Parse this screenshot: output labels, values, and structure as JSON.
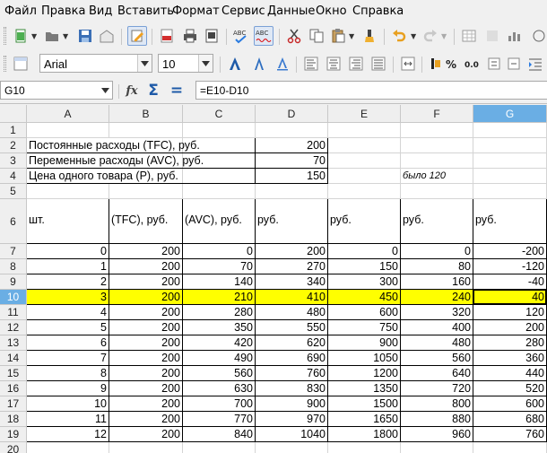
{
  "menu": [
    "Файл",
    "Правка",
    "Вид",
    "Вставить",
    "Формат",
    "Сервис",
    "Данные",
    "Окно",
    "Справка"
  ],
  "toolbar": {
    "font_name": "Arial",
    "font_size": "10",
    "icons": [
      "new-document-icon",
      "open-folder-icon",
      "save-icon",
      "email-icon",
      "edit-mode-icon",
      "export-pdf-icon",
      "print-icon",
      "print-preview-icon",
      "spellcheck-icon",
      "autospellcheck-icon",
      "cut-icon",
      "copy-icon",
      "paste-icon",
      "clone-formatting-icon",
      "undo-icon",
      "redo-icon",
      "bold-icon",
      "italic-icon",
      "underline-icon",
      "align-left-icon",
      "align-center-icon",
      "align-right-icon",
      "justify-icon",
      "merge-cells-icon",
      "currency-icon",
      "percent-icon",
      "number-format-icon"
    ]
  },
  "formula_bar": {
    "cell_ref": "G10",
    "wizard_label": "fx",
    "sum_label": "Σ",
    "equals_label": "=",
    "formula": "=E10-D10"
  },
  "colors": {
    "selection_header": "#6aaee4",
    "highlight_row": "#ffff00"
  },
  "sheet": {
    "columns": [
      "A",
      "B",
      "C",
      "D",
      "E",
      "F",
      "G"
    ],
    "selected_column": "G",
    "selected_row": "10",
    "rows": [
      "1",
      "2",
      "3",
      "4",
      "5",
      "6",
      "7",
      "8",
      "9",
      "10",
      "11",
      "12",
      "13",
      "14",
      "15",
      "16",
      "17",
      "18",
      "19",
      "20"
    ],
    "params": [
      {
        "label": "Постоянные расходы (TFC), руб.",
        "value": "200"
      },
      {
        "label": "Переменные расходы (AVC), руб.",
        "value": "70"
      },
      {
        "label": "Цена одного товара (P), руб.",
        "value": "150"
      }
    ],
    "note": "было 120",
    "table_headers": [
      "Объем производства, шт.",
      "Постоянные расходы (TFC), руб.",
      "Переменные расходы (AVC), руб.",
      "Общие расходы, руб.",
      "Выручка, руб.",
      "Маргинальный доход (MR), руб.",
      "Чистая прибыль, руб."
    ],
    "table_rows": [
      [
        "0",
        "200",
        "0",
        "200",
        "0",
        "0",
        "-200"
      ],
      [
        "1",
        "200",
        "70",
        "270",
        "150",
        "80",
        "-120"
      ],
      [
        "2",
        "200",
        "140",
        "340",
        "300",
        "160",
        "-40"
      ],
      [
        "3",
        "200",
        "210",
        "410",
        "450",
        "240",
        "40"
      ],
      [
        "4",
        "200",
        "280",
        "480",
        "600",
        "320",
        "120"
      ],
      [
        "5",
        "200",
        "350",
        "550",
        "750",
        "400",
        "200"
      ],
      [
        "6",
        "200",
        "420",
        "620",
        "900",
        "480",
        "280"
      ],
      [
        "7",
        "200",
        "490",
        "690",
        "1050",
        "560",
        "360"
      ],
      [
        "8",
        "200",
        "560",
        "760",
        "1200",
        "640",
        "440"
      ],
      [
        "9",
        "200",
        "630",
        "830",
        "1350",
        "720",
        "520"
      ],
      [
        "10",
        "200",
        "700",
        "900",
        "1500",
        "800",
        "600"
      ],
      [
        "11",
        "200",
        "770",
        "970",
        "1650",
        "880",
        "680"
      ],
      [
        "12",
        "200",
        "840",
        "1040",
        "1800",
        "960",
        "760"
      ]
    ]
  }
}
